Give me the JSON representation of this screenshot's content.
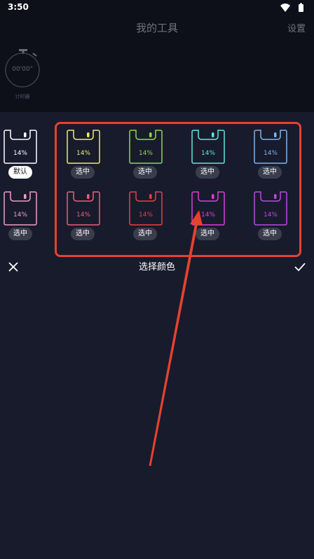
{
  "status": {
    "time": "3:50"
  },
  "header": {
    "title": "我的工具",
    "settings_label": "设置"
  },
  "widget": {
    "readout": "00'00\"",
    "label": "计时器"
  },
  "picker": {
    "title": "选择颜色",
    "percent": "14%",
    "default_label": "默认",
    "select_label": "选中",
    "colors": [
      "#ffffff",
      "#e9ee6d",
      "#8cd94c",
      "#5ee8e0",
      "#7fb3ea",
      "#f09fc1",
      "#ec5f7d",
      "#ef3d44",
      "#de3ddc",
      "#b54de2"
    ]
  },
  "icons": {
    "close": "close-icon",
    "confirm": "check-icon",
    "wifi": "wifi-icon",
    "battery": "battery-icon",
    "stopwatch": "stopwatch-icon"
  }
}
